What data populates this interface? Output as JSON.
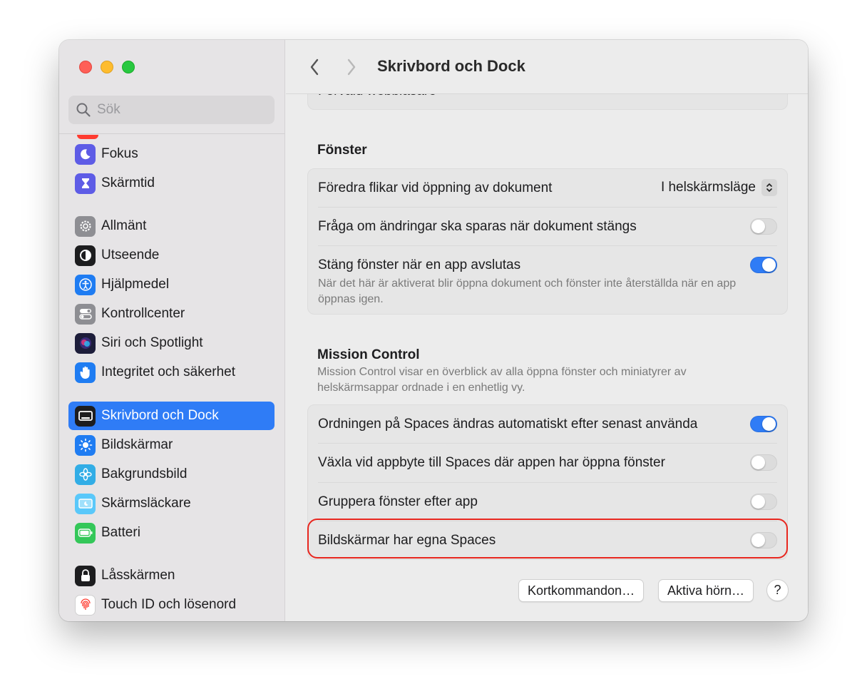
{
  "search": {
    "placeholder": "Sök"
  },
  "sidebar": {
    "items": [
      {
        "label": "Fokus",
        "icon": "moon-icon",
        "color": "#5e5ce6"
      },
      {
        "label": "Skärmtid",
        "icon": "hourglass-icon",
        "color": "#5e5ce6"
      },
      {
        "label": "Allmänt",
        "icon": "gear-icon",
        "color": "#8e8e93"
      },
      {
        "label": "Utseende",
        "icon": "appearance-icon",
        "color": "#1d1d1f"
      },
      {
        "label": "Hjälpmedel",
        "icon": "accessibility-icon",
        "color": "#1f7cf2"
      },
      {
        "label": "Kontrollcenter",
        "icon": "switches-icon",
        "color": "#8e8e93"
      },
      {
        "label": "Siri och Spotlight",
        "icon": "siri-icon",
        "color": "#2b2b50"
      },
      {
        "label": "Integritet och säkerhet",
        "icon": "hand-icon",
        "color": "#1f7cf2"
      },
      {
        "label": "Skrivbord och Dock",
        "icon": "dock-icon",
        "color": "#1d1d1f",
        "active": true
      },
      {
        "label": "Bildskärmar",
        "icon": "sun-icon",
        "color": "#1f7cf2"
      },
      {
        "label": "Bakgrundsbild",
        "icon": "flower-icon",
        "color": "#32ade6"
      },
      {
        "label": "Skärmsläckare",
        "icon": "screensaver-icon",
        "color": "#5ac8fa"
      },
      {
        "label": "Batteri",
        "icon": "battery-icon",
        "color": "#34c759"
      },
      {
        "label": "Låsskärmen",
        "icon": "lock-icon",
        "color": "#1d1d1f"
      },
      {
        "label": "Touch ID och lösenord",
        "icon": "fingerprint-icon",
        "color": "#ffffff"
      }
    ]
  },
  "header": {
    "title": "Skrivbord och Dock"
  },
  "peek": {
    "label": "Förvald webbläsare"
  },
  "sections": {
    "fonster": {
      "title": "Fönster",
      "rows": [
        {
          "label": "Föredra flikar vid öppning av dokument",
          "value": "I helskärmsläge"
        },
        {
          "label": "Fråga om ändringar ska sparas när dokument stängs",
          "on": false
        },
        {
          "label": "Stäng fönster när en app avslutas",
          "on": true,
          "sub": "När det här är aktiverat blir öppna dokument och fönster inte återställda när en app öppnas igen."
        }
      ]
    },
    "mission": {
      "title": "Mission Control",
      "sub": "Mission Control visar en överblick av alla öppna fönster och miniatyrer av helskärmsappar ordnade i en enhetlig vy.",
      "rows": [
        {
          "label": "Ordningen på Spaces ändras automatiskt efter senast använda",
          "on": true
        },
        {
          "label": "Växla vid appbyte till Spaces där appen har öppna fönster",
          "on": false
        },
        {
          "label": "Gruppera fönster efter app",
          "on": false
        },
        {
          "label": "Bildskärmar har egna Spaces",
          "on": false
        }
      ]
    }
  },
  "buttons": {
    "shortcuts": "Kortkommandon…",
    "hot_corners": "Aktiva hörn…",
    "help": "?"
  },
  "colors": {
    "accent": "#2f7cf6",
    "highlight": "#e8271f"
  }
}
